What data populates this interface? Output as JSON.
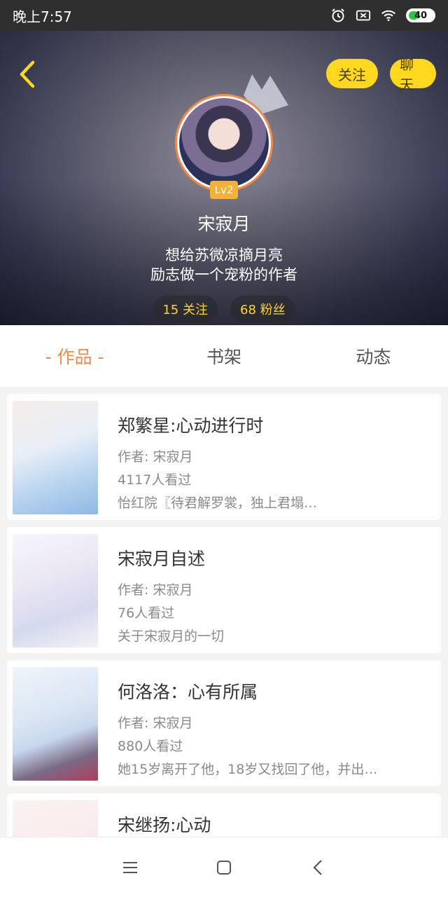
{
  "status_bar": {
    "time": "晚上7:57",
    "battery": "40"
  },
  "header": {
    "follow_label": "关注",
    "chat_label": "聊天",
    "level": "Lv2",
    "username": "宋寂月",
    "bio_line1": "想给苏微凉摘月亮",
    "bio_line2": "励志做一个宠粉的作者",
    "following": "15 关注",
    "fans": "68 粉丝"
  },
  "tabs": [
    {
      "label": "- 作品 -",
      "active": true
    },
    {
      "label": "书架",
      "active": false
    },
    {
      "label": "动态",
      "active": false
    }
  ],
  "works": [
    {
      "title": "郑繁星:心动进行时",
      "author": "作者: 宋寂月",
      "views": "4117人看过",
      "desc": "怡红院〖待君解罗裳，独上君塌…"
    },
    {
      "title": "宋寂月自述",
      "author": "作者: 宋寂月",
      "views": "76人看过",
      "desc": "关于宋寂月的一切"
    },
    {
      "title": "何洛洛：心有所属",
      "author": "作者: 宋寂月",
      "views": "880人看过",
      "desc": "她15岁离开了他，18岁又找回了他，并出…"
    },
    {
      "title": "宋继扬:心动",
      "author": "",
      "views": "",
      "desc": ""
    }
  ],
  "colors": {
    "accent_orange": "#f08a4b",
    "button_yellow": "#ffd81f",
    "stat_yellow": "#ffd23a"
  },
  "icons": {
    "back": "chevron-left-icon",
    "crown": "crown-icon",
    "nav_menu": "menu-icon",
    "nav_home": "square-icon",
    "nav_back": "back-icon"
  }
}
